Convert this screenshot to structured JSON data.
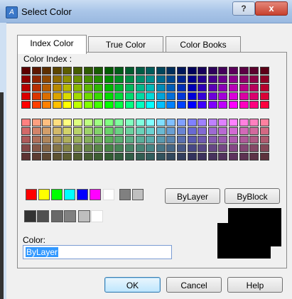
{
  "window": {
    "title": "Select Color",
    "help_glyph": "?",
    "close_glyph": "x"
  },
  "tabs": [
    {
      "label": "Index Color",
      "active": true
    },
    {
      "label": "True Color",
      "active": false
    },
    {
      "label": "Color Books",
      "active": false
    }
  ],
  "color_index_label": "Color Index :",
  "buttons": {
    "bylayer": "ByLayer",
    "byblock": "ByBlock",
    "ok": "OK",
    "cancel": "Cancel",
    "help": "Help"
  },
  "color_field": {
    "label": "Color:",
    "value": "ByLayer"
  },
  "standard_colors": [
    "#ff0000",
    "#ffff00",
    "#00ff00",
    "#00ffff",
    "#0000ff",
    "#ff00ff",
    "#ffffff",
    "#808080",
    "#c0c0c0"
  ],
  "gray_shades": [
    "#333333",
    "#505050",
    "#696969",
    "#808080",
    "#bebebe",
    "#ffffff"
  ],
  "colors": {
    "preview": "#000000",
    "selection": "#3399ff"
  }
}
